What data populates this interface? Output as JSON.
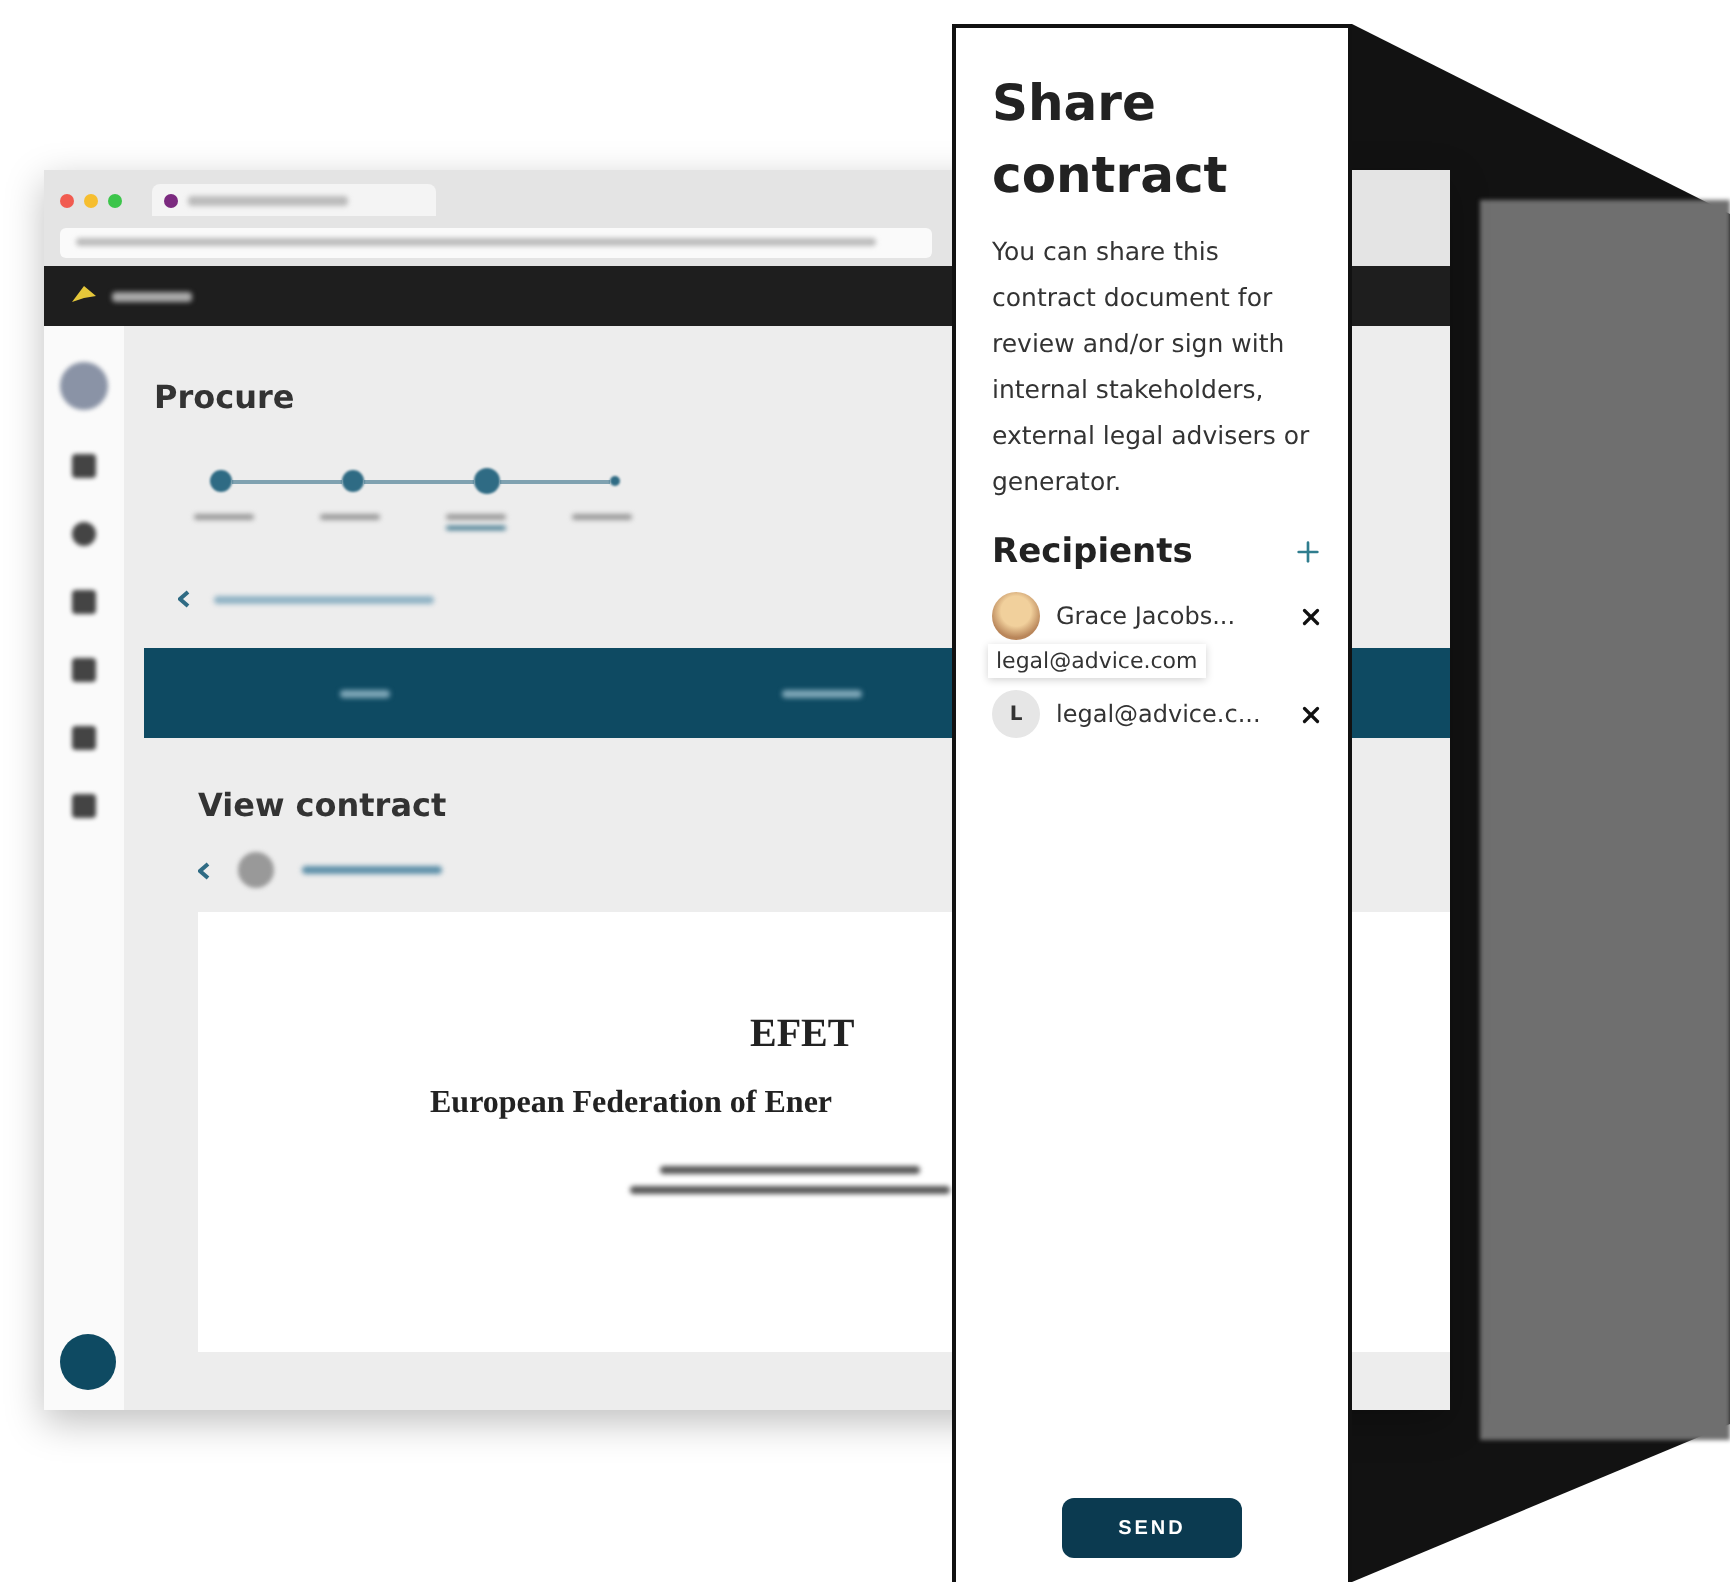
{
  "app_window": {
    "page_title": "Procure",
    "steps": [
      {
        "selected": false
      },
      {
        "selected": false
      },
      {
        "selected": true
      },
      {
        "selected": false
      }
    ],
    "section_title": "View contract",
    "document": {
      "heading": "EFET",
      "subheading": "European Federation of Ener"
    }
  },
  "share_panel": {
    "title": "Share contract",
    "description": "You can share this contract document for review and/or sign with internal stakeholders, external legal advisers or generator.",
    "recipients_heading": "Recipients",
    "recipients": [
      {
        "kind": "photo",
        "name": "Grace Jacobs..."
      },
      {
        "kind": "initial",
        "initial": "L",
        "name": "legal@advice.c..."
      }
    ],
    "tooltip": "legal@advice.com",
    "send_button": "SEND"
  }
}
